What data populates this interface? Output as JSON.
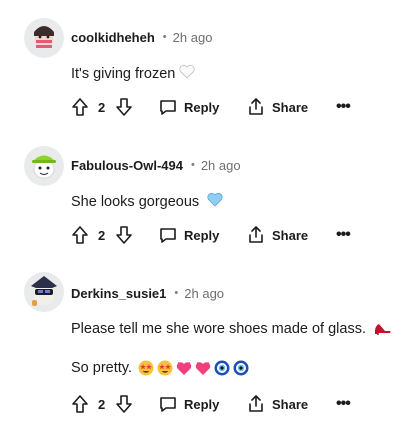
{
  "comments": [
    {
      "username": "coolkidheheh",
      "time": "2h ago",
      "text": "It's giving frozen",
      "emoji": "white-heart",
      "votes": "2",
      "reply_label": "Reply",
      "share_label": "Share",
      "more_label": "•••"
    },
    {
      "username": "Fabulous-Owl-494",
      "time": "2h ago",
      "text": "She looks gorgeous",
      "emoji": "blue-heart",
      "votes": "2",
      "reply_label": "Reply",
      "share_label": "Share",
      "more_label": "•••"
    },
    {
      "username": "Derkins_susie1",
      "time": "2h ago",
      "text": "Please tell me she wore shoes made of glass.",
      "emoji": "high-heel-shoe",
      "text2": "So pretty.",
      "emoji_row": [
        "star-struck",
        "star-struck",
        "heart",
        "heart",
        "nazar-amulet",
        "nazar-amulet"
      ],
      "votes": "2",
      "reply_label": "Reply",
      "share_label": "Share",
      "more_label": "•••"
    }
  ],
  "separator": "•"
}
